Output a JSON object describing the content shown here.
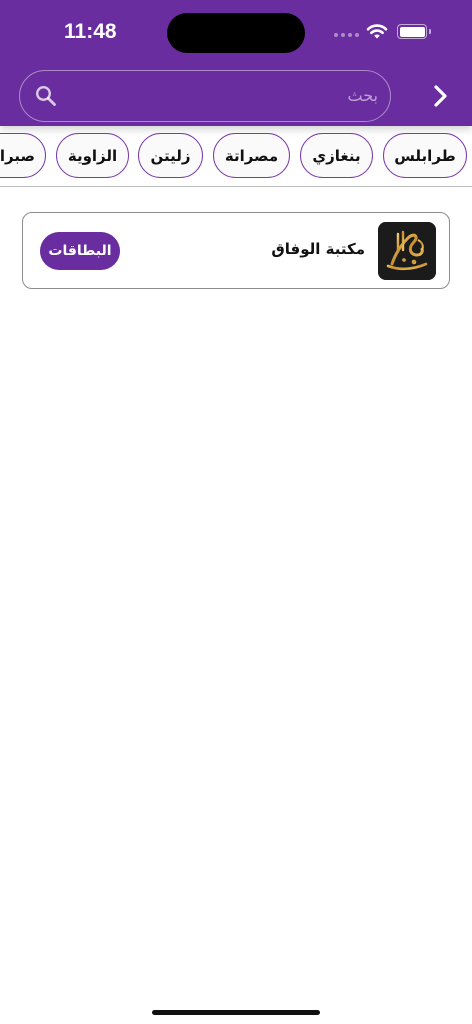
{
  "status_bar": {
    "time": "11:48"
  },
  "search": {
    "placeholder": "بحث",
    "value": ""
  },
  "chips": [
    "طرابلس",
    "بنغازي",
    "مصراتة",
    "زليتن",
    "الزاوية",
    "صبراتة"
  ],
  "card": {
    "title": "مكتبة الوفاق",
    "button_label": "البطاقات",
    "logo_text": "الوفاق"
  },
  "colors": {
    "primary": "#6a2d9f",
    "chip_border": "#7a3aa8",
    "logo_gold": "#d4a64a"
  },
  "icons": [
    "wifi-icon",
    "battery-icon",
    "search-icon",
    "chevron-right-icon"
  ]
}
